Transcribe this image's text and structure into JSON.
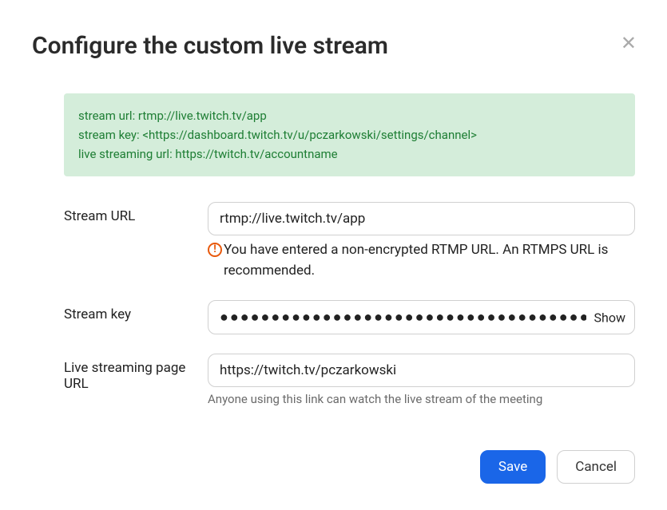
{
  "modal": {
    "title": "Configure the custom live stream",
    "info": {
      "line1": "stream url: rtmp://live.twitch.tv/app",
      "line2": "stream key: <https://dashboard.twitch.tv/u/pczarkowski/settings/channel>",
      "line3": "live streaming url: https://twitch.tv/accountname"
    },
    "fields": {
      "stream_url": {
        "label": "Stream URL",
        "value": "rtmp://live.twitch.tv/app",
        "warning": "You have entered a non-encrypted RTMP URL. An RTMPS URL is recommended."
      },
      "stream_key": {
        "label": "Stream key",
        "value": "●●●●●●●●●●●●●●●●●●●●●●●●●●●●●●●●●●●●●●●●●●",
        "show_label": "Show"
      },
      "page_url": {
        "label": "Live streaming page URL",
        "value": "https://twitch.tv/pczarkowski",
        "help": "Anyone using this link can watch the live stream of the meeting"
      }
    },
    "buttons": {
      "save": "Save",
      "cancel": "Cancel"
    }
  }
}
